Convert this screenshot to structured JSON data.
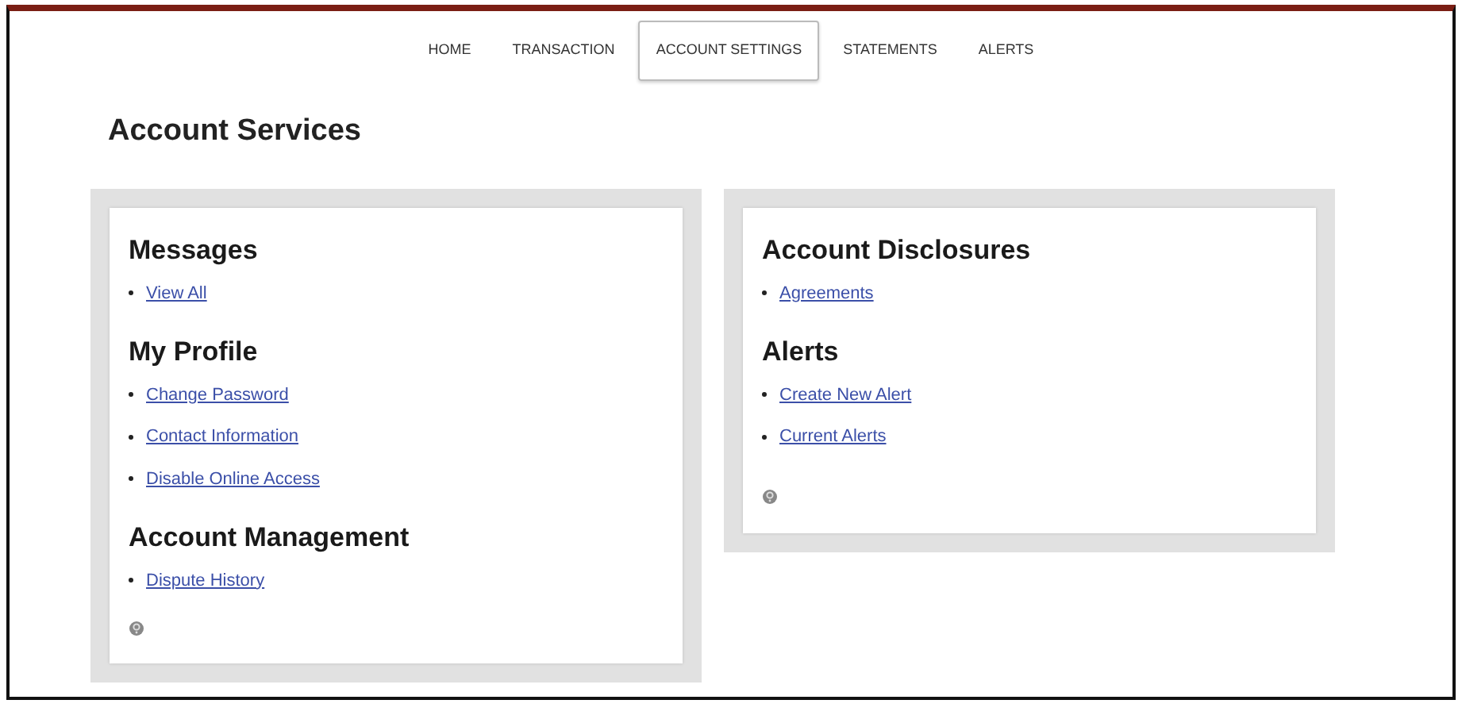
{
  "nav": [
    {
      "label": "HOME",
      "selected": false
    },
    {
      "label": "TRANSACTION",
      "selected": false
    },
    {
      "label": "ACCOUNT SETTINGS",
      "selected": true
    },
    {
      "label": "STATEMENTS",
      "selected": false
    },
    {
      "label": "ALERTS",
      "selected": false
    }
  ],
  "title": "Account Services",
  "panels": [
    {
      "sections": [
        {
          "heading": "Messages",
          "links": [
            "View All"
          ]
        },
        {
          "heading": "My Profile",
          "links": [
            "Change Password",
            "Contact Information",
            "Disable Online Access"
          ]
        },
        {
          "heading": "Account Management",
          "links": [
            "Dispute History"
          ]
        }
      ]
    },
    {
      "sections": [
        {
          "heading": "Account Disclosures",
          "links": [
            "Agreements"
          ]
        },
        {
          "heading": "Alerts",
          "links": [
            "Create New Alert",
            "Current Alerts"
          ]
        }
      ]
    }
  ]
}
